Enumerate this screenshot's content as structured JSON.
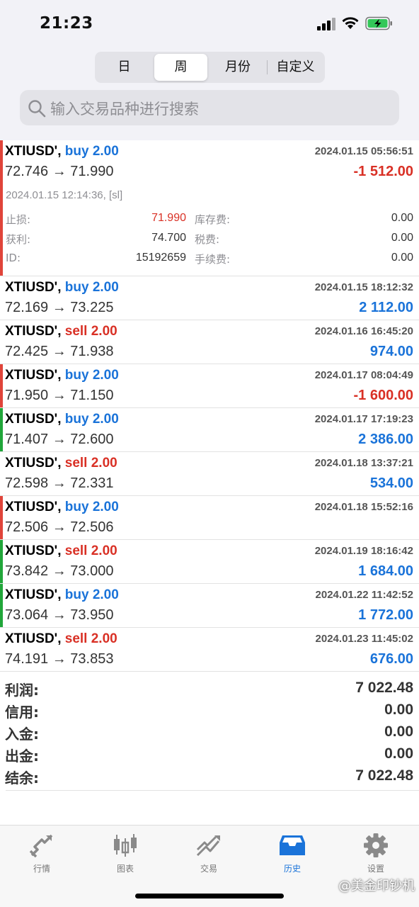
{
  "status": {
    "time": "21:23"
  },
  "tabs": {
    "day": "日",
    "week": "周",
    "month": "月份",
    "custom": "自定义"
  },
  "search": {
    "placeholder": "输入交易品种进行搜索"
  },
  "trades": [
    {
      "symbol": "XTIUSD'",
      "side": "buy 2.00",
      "side_type": "buy",
      "open_time": "2024.01.15 05:56:51",
      "prices": "72.746 → 71.990",
      "profit": "-1 512.00",
      "profit_sign": "neg",
      "marker": "#e0443a",
      "expanded": true,
      "close_time": "2024.01.15 12:14:36, [sl]",
      "details": {
        "sl_label": "止损:",
        "sl_value": "71.990",
        "tp_label": "获利:",
        "tp_value": "74.700",
        "id_label": "ID:",
        "id_value": "15192659",
        "swap_label": "库存费:",
        "swap_value": "0.00",
        "tax_label": "税费:",
        "tax_value": "0.00",
        "fee_label": "手续费:",
        "fee_value": "0.00"
      }
    },
    {
      "symbol": "XTIUSD'",
      "side": "buy 2.00",
      "side_type": "buy",
      "open_time": "2024.01.15 18:12:32",
      "prices": "72.169 → 73.225",
      "profit": "2 112.00",
      "profit_sign": "pos",
      "marker": ""
    },
    {
      "symbol": "XTIUSD'",
      "side": "sell 2.00",
      "side_type": "sell",
      "open_time": "2024.01.16 16:45:20",
      "prices": "72.425 → 71.938",
      "profit": "974.00",
      "profit_sign": "pos",
      "marker": ""
    },
    {
      "symbol": "XTIUSD'",
      "side": "buy 2.00",
      "side_type": "buy",
      "open_time": "2024.01.17 08:04:49",
      "prices": "71.950 → 71.150",
      "profit": "-1 600.00",
      "profit_sign": "neg",
      "marker": "#e0443a"
    },
    {
      "symbol": "XTIUSD'",
      "side": "buy 2.00",
      "side_type": "buy",
      "open_time": "2024.01.17 17:19:23",
      "prices": "71.407 → 72.600",
      "profit": "2 386.00",
      "profit_sign": "pos",
      "marker": "#21a63a"
    },
    {
      "symbol": "XTIUSD'",
      "side": "sell 2.00",
      "side_type": "sell",
      "open_time": "2024.01.18 13:37:21",
      "prices": "72.598 → 72.331",
      "profit": "534.00",
      "profit_sign": "pos",
      "marker": ""
    },
    {
      "symbol": "XTIUSD'",
      "side": "buy 2.00",
      "side_type": "buy",
      "open_time": "2024.01.18 15:52:16",
      "prices": "72.506 → 72.506",
      "profit": "",
      "profit_sign": "pos",
      "marker": "#e0443a"
    },
    {
      "symbol": "XTIUSD'",
      "side": "sell 2.00",
      "side_type": "sell",
      "open_time": "2024.01.19 18:16:42",
      "prices": "73.842 → 73.000",
      "profit": "1 684.00",
      "profit_sign": "pos",
      "marker": "#21a63a"
    },
    {
      "symbol": "XTIUSD'",
      "side": "buy 2.00",
      "side_type": "buy",
      "open_time": "2024.01.22 11:42:52",
      "prices": "73.064 → 73.950",
      "profit": "1 772.00",
      "profit_sign": "pos",
      "marker": "#21a63a"
    },
    {
      "symbol": "XTIUSD'",
      "side": "sell 2.00",
      "side_type": "sell",
      "open_time": "2024.01.23 11:45:02",
      "prices": "74.191 → 73.853",
      "profit": "676.00",
      "profit_sign": "pos",
      "marker": ""
    }
  ],
  "summary": [
    {
      "label": "利润:",
      "value": "7 022.48"
    },
    {
      "label": "信用:",
      "value": "0.00"
    },
    {
      "label": "入金:",
      "value": "0.00"
    },
    {
      "label": "出金:",
      "value": "0.00"
    },
    {
      "label": "结余:",
      "value": "7 022.48"
    }
  ],
  "tabbar": [
    {
      "label": "行情",
      "icon": "quotes-icon"
    },
    {
      "label": "图表",
      "icon": "chart-icon"
    },
    {
      "label": "交易",
      "icon": "trade-icon"
    },
    {
      "label": "历史",
      "icon": "history-icon",
      "active": true
    },
    {
      "label": "设置",
      "icon": "settings-icon"
    }
  ],
  "watermark": "@美金印钞机",
  "colors": {
    "buy": "#1a73d9",
    "sell": "#d93025",
    "active_tab": "#1a73d9"
  }
}
